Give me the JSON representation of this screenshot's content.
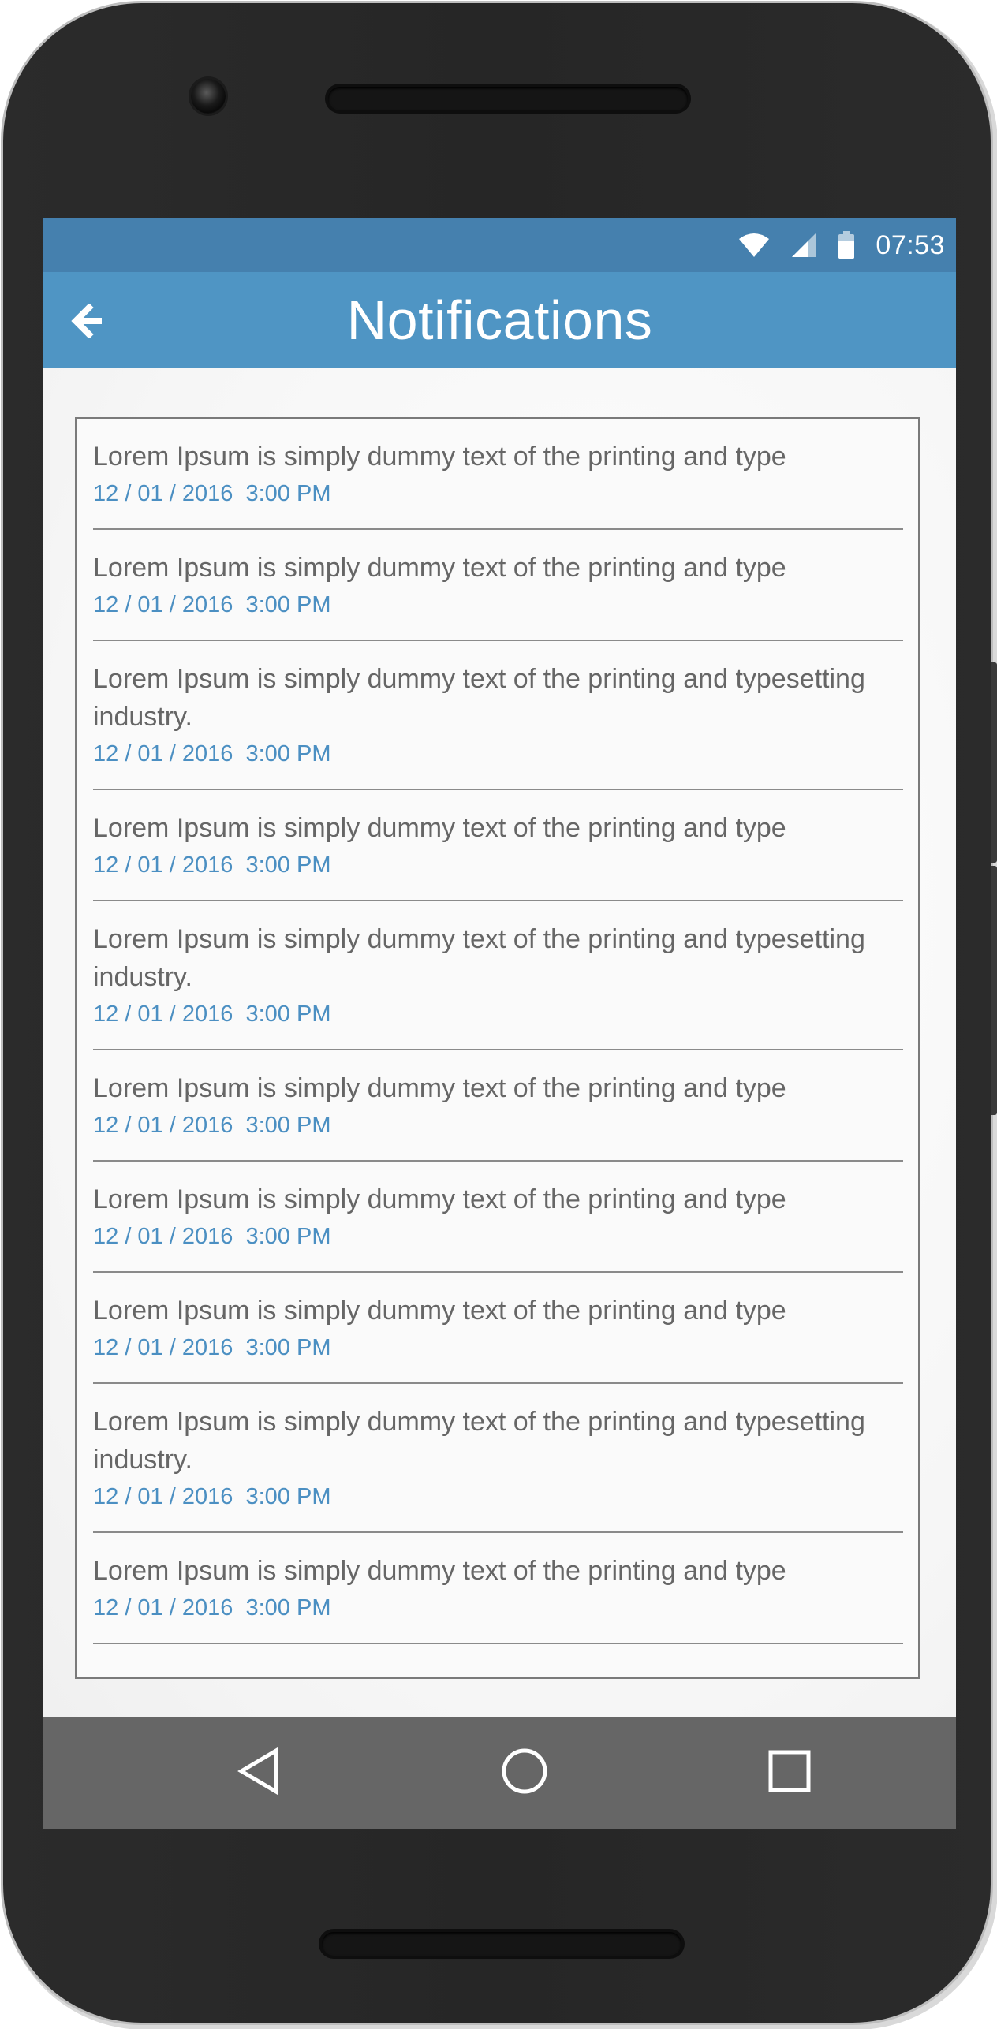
{
  "status_bar": {
    "time": "07:53",
    "icons": [
      "wifi-icon",
      "cellular-signal-icon",
      "battery-icon"
    ]
  },
  "app_bar": {
    "title": "Notifications",
    "back_icon": "arrow-left-icon"
  },
  "notifications": [
    {
      "text": "Lorem Ipsum is simply dummy text of the printing and type",
      "time": "12 / 01 / 2016  3:00 PM"
    },
    {
      "text": "Lorem Ipsum is simply dummy text of the printing and type",
      "time": "12 / 01 / 2016  3:00 PM"
    },
    {
      "text": "Lorem Ipsum is simply dummy text of the printing and typesetting industry.",
      "time": "12 / 01 / 2016  3:00 PM"
    },
    {
      "text": "Lorem Ipsum is simply dummy text of the printing and type",
      "time": "12 / 01 / 2016  3:00 PM"
    },
    {
      "text": "Lorem Ipsum is simply dummy text of the printing and typesetting industry.",
      "time": "12 / 01 / 2016  3:00 PM"
    },
    {
      "text": "Lorem Ipsum is simply dummy text of the printing and type",
      "time": "12 / 01 / 2016  3:00 PM"
    },
    {
      "text": "Lorem Ipsum is simply dummy text of the printing and type",
      "time": "12 / 01 / 2016  3:00 PM"
    },
    {
      "text": "Lorem Ipsum is simply dummy text of the printing and type",
      "time": "12 / 01 / 2016  3:00 PM"
    },
    {
      "text": "Lorem Ipsum is simply dummy text of the printing and typesetting industry.",
      "time": "12 / 01 / 2016  3:00 PM"
    },
    {
      "text": "Lorem Ipsum is simply dummy text of the printing and type",
      "time": "12 / 01 / 2016  3:00 PM"
    }
  ],
  "nav_bar": {
    "buttons": [
      "nav-back-triangle-icon",
      "nav-home-circle-icon",
      "nav-recents-square-icon"
    ]
  },
  "colors": {
    "status_bar": "#4580ae",
    "app_bar": "#4f95c4",
    "timestamp": "#4b8fc2",
    "body_text": "#666666",
    "nav_bar": "#666666",
    "phone_body": "#262626"
  }
}
